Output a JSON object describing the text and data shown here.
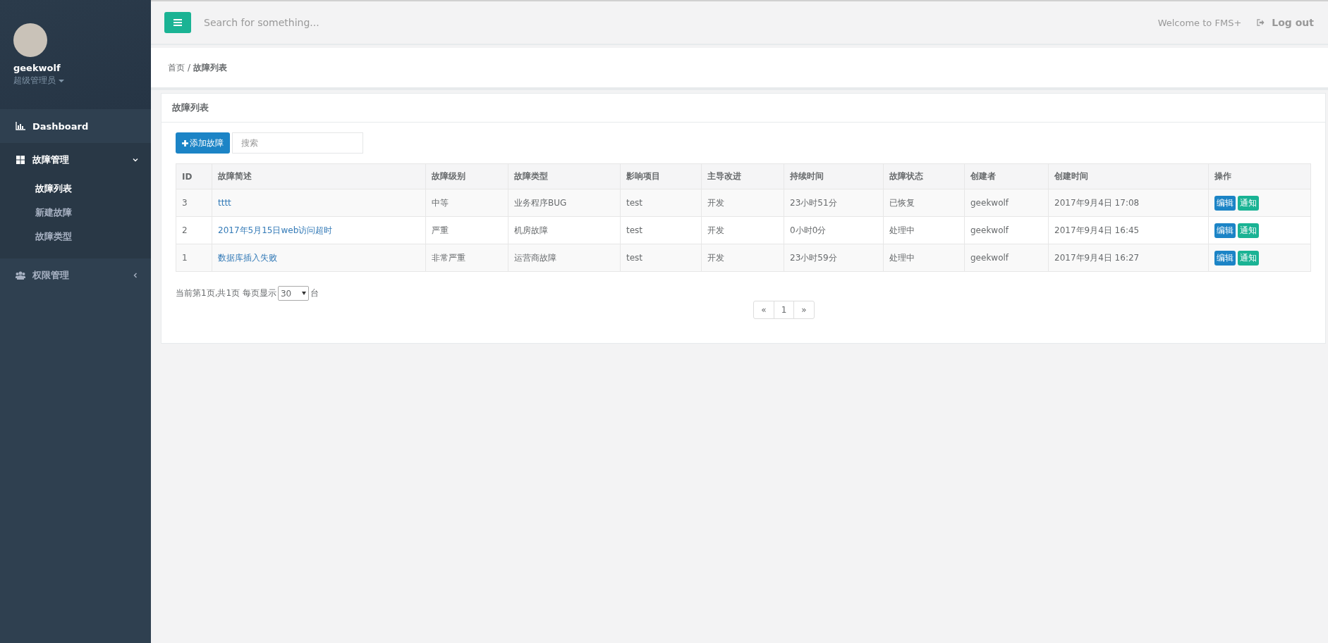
{
  "sidebar": {
    "user": {
      "name": "geekwolf",
      "role": "超级管理员"
    },
    "menu": [
      {
        "label": "Dashboard"
      },
      {
        "label": "故障管理",
        "expanded": true,
        "children": [
          {
            "label": "故障列表",
            "selected": true
          },
          {
            "label": "新建故障",
            "selected": false
          },
          {
            "label": "故障类型",
            "selected": false
          }
        ]
      },
      {
        "label": "权限管理",
        "expanded": false
      }
    ]
  },
  "topbar": {
    "search": {
      "placeholder": "Search for something..."
    },
    "welcome": "Welcome to FMS+",
    "logout": "Log out"
  },
  "breadcrumb_separator": "/",
  "breadcrumb": [
    {
      "label": "首页",
      "selected": false
    },
    {
      "label": "故障列表",
      "selected": true
    }
  ],
  "panel": {
    "title": "故障列表",
    "add_button": "添加故障",
    "search": {
      "placeholder": "搜索"
    }
  },
  "table": {
    "columns": [
      "ID",
      "故障简述",
      "故障级别",
      "故障类型",
      "影响项目",
      "主导改进",
      "持续时间",
      "故障状态",
      "创建者",
      "创建时间",
      "操作"
    ],
    "rows": [
      {
        "id": "3",
        "summary": "tttt",
        "level": "中等",
        "type": "业务程序BUG",
        "project": "test",
        "lead": "开发",
        "duration": "23小时51分",
        "status": "已恢复",
        "creator": "geekwolf",
        "created": "2017年9月4日 17:08",
        "actions": [
          {
            "label": "编辑",
            "kind": "primary"
          },
          {
            "label": "通知",
            "kind": "success"
          }
        ]
      },
      {
        "id": "2",
        "summary": "2017年5月15日web访问超时",
        "level": "严重",
        "type": "机房故障",
        "project": "test",
        "lead": "开发",
        "duration": "0小时0分",
        "status": "处理中",
        "creator": "geekwolf",
        "created": "2017年9月4日 16:45",
        "actions": [
          {
            "label": "编辑",
            "kind": "primary"
          },
          {
            "label": "通知",
            "kind": "success"
          }
        ]
      },
      {
        "id": "1",
        "summary": "数据库插入失败",
        "level": "非常严重",
        "type": "运营商故障",
        "project": "test",
        "lead": "开发",
        "duration": "23小时59分",
        "status": "处理中",
        "creator": "geekwolf",
        "created": "2017年9月4日 16:27",
        "actions": [
          {
            "label": "编辑",
            "kind": "primary"
          },
          {
            "label": "通知",
            "kind": "success"
          }
        ]
      }
    ]
  },
  "footer": {
    "summary": "当前第1页,共1页 每页显示",
    "page_size": "30",
    "unit": "台"
  },
  "pagination": [
    "«",
    "1",
    "»"
  ]
}
